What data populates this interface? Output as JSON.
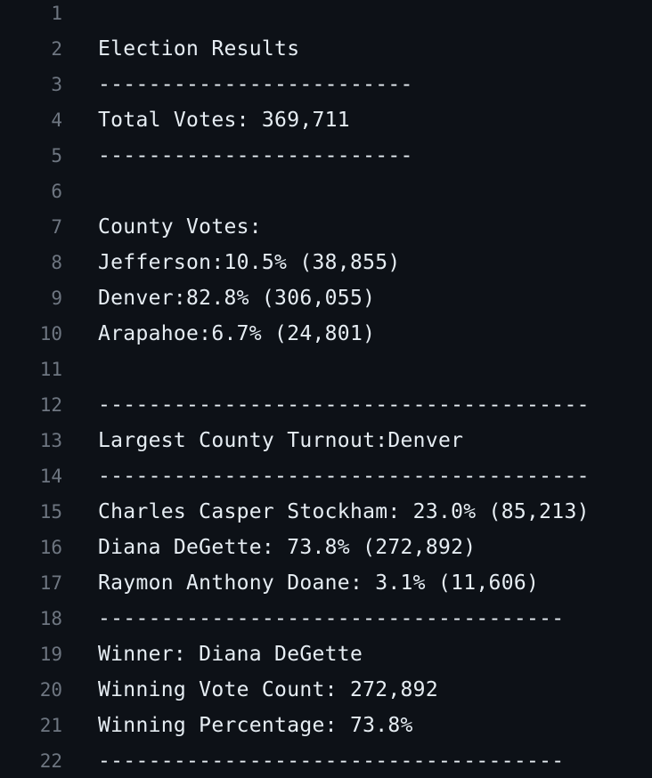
{
  "editor": {
    "lines": [
      {
        "num": "1",
        "text": ""
      },
      {
        "num": "2",
        "text": "Election Results"
      },
      {
        "num": "3",
        "text": "-------------------------"
      },
      {
        "num": "4",
        "text": "Total Votes: 369,711"
      },
      {
        "num": "5",
        "text": "-------------------------"
      },
      {
        "num": "6",
        "text": ""
      },
      {
        "num": "7",
        "text": "County Votes:"
      },
      {
        "num": "8",
        "text": "Jefferson:10.5% (38,855)"
      },
      {
        "num": "9",
        "text": "Denver:82.8% (306,055)"
      },
      {
        "num": "10",
        "text": "Arapahoe:6.7% (24,801)"
      },
      {
        "num": "11",
        "text": ""
      },
      {
        "num": "12",
        "text": "---------------------------------------"
      },
      {
        "num": "13",
        "text": "Largest County Turnout:Denver"
      },
      {
        "num": "14",
        "text": "---------------------------------------"
      },
      {
        "num": "15",
        "text": "Charles Casper Stockham: 23.0% (85,213)"
      },
      {
        "num": "16",
        "text": "Diana DeGette: 73.8% (272,892)"
      },
      {
        "num": "17",
        "text": "Raymon Anthony Doane: 3.1% (11,606)"
      },
      {
        "num": "18",
        "text": "-------------------------------------"
      },
      {
        "num": "19",
        "text": "Winner: Diana DeGette"
      },
      {
        "num": "20",
        "text": "Winning Vote Count: 272,892"
      },
      {
        "num": "21",
        "text": "Winning Percentage: 73.8%"
      },
      {
        "num": "22",
        "text": "-------------------------------------"
      }
    ]
  }
}
